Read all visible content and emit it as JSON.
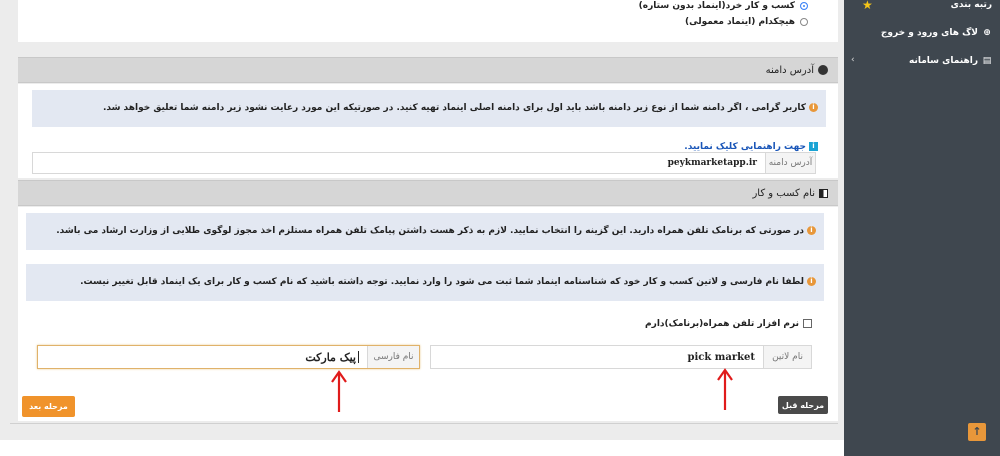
{
  "sidebar": {
    "items": [
      {
        "label": "رتبه بندی",
        "icon": "star-icon"
      },
      {
        "label": "لاگ های ورود و خروج",
        "icon": "plus-circle-icon"
      },
      {
        "label": "راهنمای سامانه",
        "icon": "document-icon"
      }
    ],
    "collapse_icon": "chevron-left-icon",
    "scroll_top_icon": "arrow-up-icon"
  },
  "trust": {
    "option_star_free": "کسب و کار خرد(اینماد بدون ستاره)",
    "option_none": "هیچکدام (اینماد معمولی)"
  },
  "domain_section": {
    "title": "آدرس دامنه",
    "alert": "کاربر گرامی ، اگر دامنه شما از نوع زیر دامنه باشد باید اول برای دامنه اصلی اینماد تهیه کنید. در صورتیکه این مورد رعایت نشود زیر دامنه شما تعلیق خواهد شد.",
    "guide_link": "جهت راهنمایی کلیک نمایید.",
    "field_label": "آدرس دامنه",
    "field_value": "peykmarketapp.ir"
  },
  "business_section": {
    "title": "نام کسب و کار",
    "alert_app": "در صورتی که برنامک تلفن همراه دارید. این گزینه را انتخاب نمایید. لازم به ذکر هست داشتن پیامک تلفن همراه مستلزم اخذ مجوز لوگوی طلایی از وزارت ارشاد می باشد.",
    "alert_name": "لطفا نام فارسی و لاتین کسب و کار خود که شناسنامه اینماد شما ثبت می شود را وارد نمایید. توجه داشته باشید که نام کسب و کار برای یک اینماد قابل تغییر نیست.",
    "checkbox_label": "نرم افزار تلفن همراه(برنامک)دارم",
    "latin_label": "نام لاتین",
    "latin_value": "pick market",
    "persian_label": "نام فارسی",
    "persian_value": "پیک مارکت"
  },
  "buttons": {
    "next": "مرحله بعد",
    "prev": "مرحله قبل"
  },
  "colors": {
    "accent_orange": "#f0932b",
    "sidebar_bg": "#3f474f",
    "alert_bg": "#e3e8f2",
    "arrow_red": "#e01b1b",
    "dark_button": "#4a4a4a"
  }
}
